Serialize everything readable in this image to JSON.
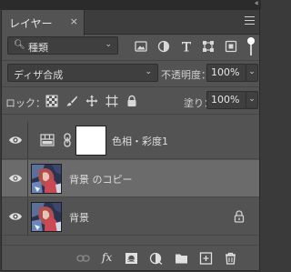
{
  "panel": {
    "tab_label": "レイヤー",
    "tab_close": "×",
    "collapse_glyph": "‹‹",
    "menu_icon": "menu-icon"
  },
  "filter": {
    "kind_label": "種類",
    "filter_icons": [
      "image-filter-icon",
      "adjustment-filter-icon",
      "type-filter-icon",
      "shape-filter-icon",
      "smart-object-filter-icon"
    ],
    "filter_enabled": true
  },
  "blend": {
    "mode": "ディザ合成",
    "opacity_label": "不透明度：",
    "opacity_value": "100%"
  },
  "lock": {
    "label": "ロック：",
    "icons": [
      "lock-transparent-icon",
      "lock-paint-icon",
      "lock-position-icon",
      "lock-artboard-icon",
      "lock-all-icon"
    ],
    "fill_label": "塗り：",
    "fill_value": "100%"
  },
  "layers": [
    {
      "name": "色相・彩度1",
      "type": "adjustment",
      "visible": true,
      "selected": false,
      "locked": false
    },
    {
      "name": "背景 のコピー",
      "type": "pixel",
      "visible": true,
      "selected": true,
      "locked": false
    },
    {
      "name": "背景",
      "type": "pixel",
      "visible": true,
      "selected": false,
      "locked": true
    }
  ],
  "bottom_bar": {
    "fx_label": "fx",
    "icons": [
      "link-layers-icon",
      "fx-icon",
      "add-mask-icon",
      "new-adjustment-icon",
      "new-group-icon",
      "new-layer-icon",
      "delete-layer-icon"
    ]
  },
  "colors": {
    "panel_bg": "#535353",
    "selected_row": "#6b6b6b",
    "field_bg": "#3f3f3f"
  }
}
